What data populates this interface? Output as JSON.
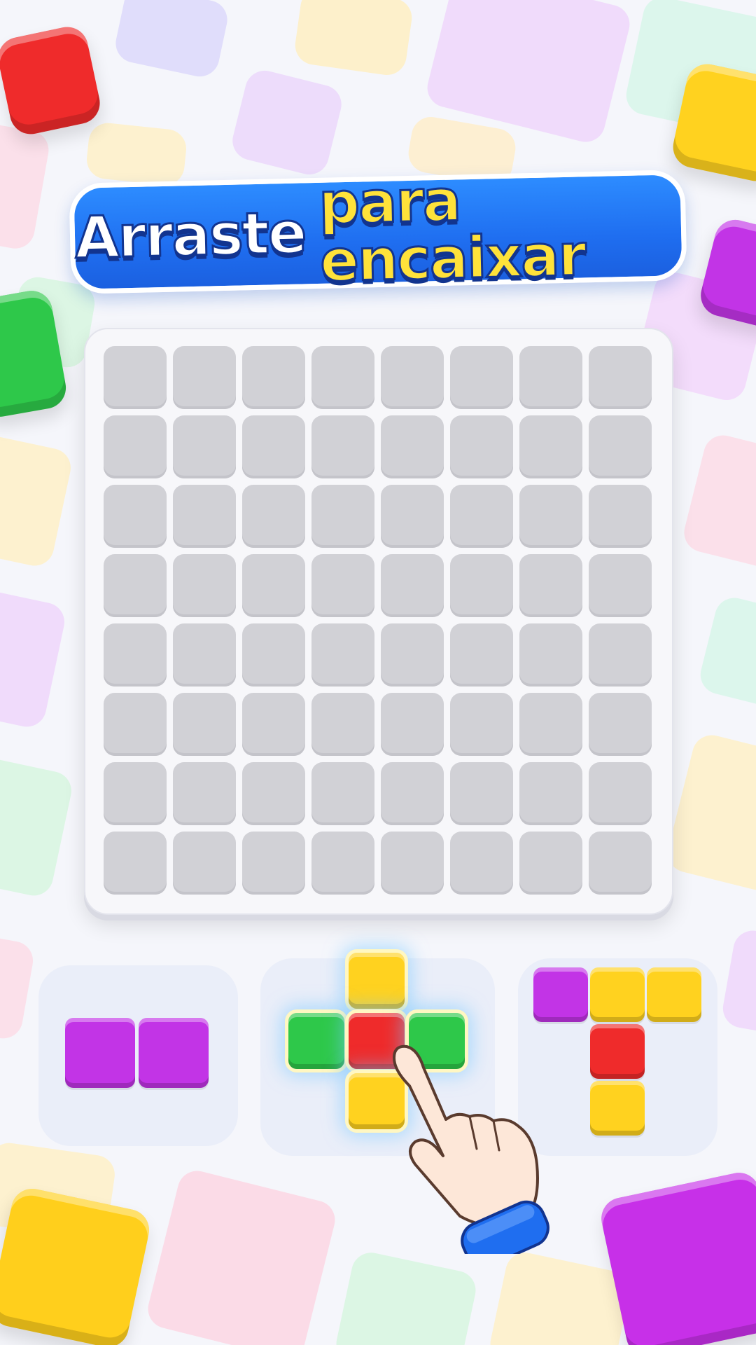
{
  "title": {
    "part1": "Arraste",
    "part2": "para encaixar"
  },
  "board": {
    "rows": 8,
    "cols": 8,
    "filled_cells": 0
  },
  "tray": [
    {
      "name": "domino",
      "color": "#c234e6",
      "cells": [
        [
          0,
          0
        ],
        [
          1,
          0
        ]
      ]
    },
    {
      "name": "plus",
      "cells": [
        {
          "pos": [
            1,
            0
          ],
          "color": "#ffd21f"
        },
        {
          "pos": [
            0,
            1
          ],
          "color": "#2ec84a"
        },
        {
          "pos": [
            1,
            1
          ],
          "color": "#ef2b2b"
        },
        {
          "pos": [
            2,
            1
          ],
          "color": "#2ec84a"
        },
        {
          "pos": [
            1,
            2
          ],
          "color": "#ffd21f"
        }
      ],
      "selected": true
    },
    {
      "name": "t-piece",
      "cells": [
        {
          "pos": [
            0,
            0
          ],
          "color": "#c234e6"
        },
        {
          "pos": [
            1,
            0
          ],
          "color": "#ffd21f"
        },
        {
          "pos": [
            2,
            0
          ],
          "color": "#ffd21f"
        },
        {
          "pos": [
            1,
            1
          ],
          "color": "#ef2b2b"
        },
        {
          "pos": [
            1,
            2
          ],
          "color": "#ffd21f"
        }
      ]
    }
  ],
  "colors": {
    "banner_blue": "#1f6ef0",
    "title_white": "#ffffff",
    "title_yellow": "#ffe23a",
    "empty_cell": "#d1d1d6",
    "red": "#ef2b2b",
    "yellow": "#ffd21f",
    "green": "#2ec84a",
    "purple": "#c234e6"
  },
  "icons": {
    "pointer": "pointing-hand-icon"
  }
}
